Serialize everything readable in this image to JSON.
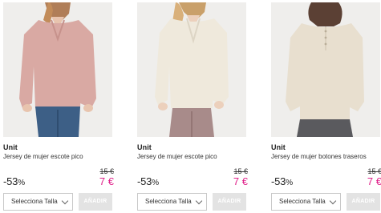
{
  "products": [
    {
      "brand": "Unit",
      "name": "Jersey de mujer escote pico",
      "old_price": "15 €",
      "discount": "-53",
      "discount_unit": "%",
      "new_price": "7 €",
      "size_placeholder": "Selecciona Talla",
      "add_label": "AÑADIR",
      "colors": {
        "sweater": "#d9a9a3",
        "sweater_shade": "#c7928c",
        "bottom": "#3d5f86"
      }
    },
    {
      "brand": "Unit",
      "name": "Jersey de mujer escote pico",
      "old_price": "15 €",
      "discount": "-53",
      "discount_unit": "%",
      "new_price": "7 €",
      "size_placeholder": "Selecciona Talla",
      "add_label": "AÑADIR",
      "colors": {
        "sweater": "#efe9dc",
        "sweater_shade": "#ddd5c5",
        "bottom": "#a88b8a"
      }
    },
    {
      "brand": "Unit",
      "name": "Jersey de mujer botones traseros",
      "old_price": "15 €",
      "discount": "-53",
      "discount_unit": "%",
      "new_price": "7 €",
      "size_placeholder": "Selecciona Talla",
      "add_label": "AÑADIR",
      "colors": {
        "sweater": "#e8dfcf",
        "sweater_shade": "#d6cbb8",
        "bottom": "#5a5a5e"
      }
    }
  ]
}
